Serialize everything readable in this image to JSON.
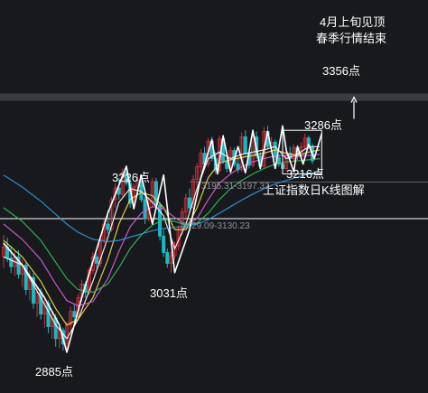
{
  "chart_data": {
    "type": "candlestick",
    "title": "上证指数日K线图解",
    "title_bottom": "",
    "note_lines": [
      "4月上旬见顶",
      "春季行情结束"
    ],
    "y_range": [
      2860,
      3400
    ],
    "grid": false,
    "colors": {
      "background": "#18191d",
      "up": "#d8323a",
      "down": "#1db8c2",
      "zigzag": "#ffffff",
      "ma5": "#ffffff",
      "ma10": "#f3e04a",
      "ma20": "#d95fd8",
      "ma30": "#33c05a",
      "ma60": "#2e9be6",
      "band": "#3a3b40"
    },
    "reference_lines": [
      3130,
      3197,
      3356
    ],
    "gaps": [
      {
        "label": "3195.31-3197.32",
        "low": 3195.31,
        "high": 3197.32
      },
      {
        "label": "3129.09-3130.23",
        "low": 3129.09,
        "high": 3130.23
      }
    ],
    "key_points": [
      {
        "label": "2885点",
        "value": 2885
      },
      {
        "label": "3226点",
        "value": 3226
      },
      {
        "label": "3031点",
        "value": 3031
      },
      {
        "label": "3286点",
        "value": 3286
      },
      {
        "label": "3216点",
        "value": 3216
      },
      {
        "label": "3356点",
        "value": 3356
      }
    ],
    "zigzag": [
      [
        0,
        3085
      ],
      [
        10,
        3045
      ],
      [
        22,
        2985
      ],
      [
        30,
        2935
      ],
      [
        34,
        2885
      ],
      [
        42,
        2985
      ],
      [
        56,
        3140
      ],
      [
        66,
        3226
      ],
      [
        70,
        3148
      ],
      [
        74,
        3210
      ],
      [
        80,
        3120
      ],
      [
        86,
        3210
      ],
      [
        92,
        3031
      ],
      [
        100,
        3110
      ],
      [
        106,
        3205
      ],
      [
        112,
        3275
      ],
      [
        115,
        3212
      ],
      [
        118,
        3282
      ],
      [
        122,
        3215
      ],
      [
        126,
        3262
      ],
      [
        130,
        3214
      ],
      [
        134,
        3292
      ],
      [
        138,
        3222
      ],
      [
        142,
        3290
      ],
      [
        146,
        3222
      ],
      [
        150,
        3300
      ],
      [
        152,
        3255
      ],
      [
        156,
        3216
      ],
      [
        158,
        3262
      ],
      [
        161,
        3230
      ],
      [
        164,
        3266
      ],
      [
        167,
        3240
      ],
      [
        171,
        3286
      ]
    ],
    "candles": [
      [
        0,
        3060,
        3100,
        3040,
        3078
      ],
      [
        2,
        3078,
        3095,
        3050,
        3058
      ],
      [
        4,
        3058,
        3080,
        3030,
        3042
      ],
      [
        6,
        3042,
        3070,
        3025,
        3060
      ],
      [
        8,
        3060,
        3072,
        3020,
        3028
      ],
      [
        10,
        3028,
        3055,
        3005,
        3045
      ],
      [
        12,
        3045,
        3050,
        2990,
        3000
      ],
      [
        14,
        3000,
        3035,
        2980,
        3022
      ],
      [
        16,
        3022,
        3030,
        2965,
        2975
      ],
      [
        18,
        2975,
        3005,
        2950,
        2995
      ],
      [
        20,
        2995,
        3002,
        2945,
        2955
      ],
      [
        22,
        2955,
        2985,
        2930,
        2975
      ],
      [
        24,
        2975,
        2980,
        2920,
        2932
      ],
      [
        26,
        2932,
        2960,
        2910,
        2948
      ],
      [
        28,
        2948,
        2955,
        2895,
        2910
      ],
      [
        30,
        2910,
        2935,
        2892,
        2925
      ],
      [
        32,
        2925,
        2930,
        2888,
        2900
      ],
      [
        34,
        2900,
        2940,
        2885,
        2935
      ],
      [
        36,
        2935,
        2968,
        2925,
        2960
      ],
      [
        38,
        2960,
        2972,
        2940,
        2950
      ],
      [
        40,
        2950,
        2992,
        2945,
        2985
      ],
      [
        42,
        2985,
        3018,
        2978,
        3010
      ],
      [
        44,
        3010,
        3015,
        2985,
        2995
      ],
      [
        46,
        2995,
        3040,
        2990,
        3035
      ],
      [
        48,
        3035,
        3068,
        3028,
        3060
      ],
      [
        50,
        3060,
        3066,
        3040,
        3048
      ],
      [
        52,
        3048,
        3098,
        3042,
        3092
      ],
      [
        54,
        3092,
        3128,
        3085,
        3120
      ],
      [
        56,
        3120,
        3145,
        3102,
        3110
      ],
      [
        58,
        3110,
        3170,
        3106,
        3165
      ],
      [
        60,
        3165,
        3195,
        3150,
        3186
      ],
      [
        62,
        3186,
        3205,
        3165,
        3175
      ],
      [
        64,
        3175,
        3222,
        3170,
        3215
      ],
      [
        66,
        3215,
        3226,
        3190,
        3195
      ],
      [
        68,
        3195,
        3205,
        3150,
        3158
      ],
      [
        70,
        3158,
        3195,
        3148,
        3188
      ],
      [
        72,
        3188,
        3210,
        3172,
        3200
      ],
      [
        74,
        3200,
        3205,
        3160,
        3165
      ],
      [
        76,
        3165,
        3175,
        3120,
        3130
      ],
      [
        78,
        3130,
        3170,
        3125,
        3160
      ],
      [
        80,
        3160,
        3205,
        3150,
        3198
      ],
      [
        82,
        3198,
        3205,
        3150,
        3155
      ],
      [
        84,
        3155,
        3160,
        3090,
        3098
      ],
      [
        86,
        3098,
        3110,
        3060,
        3068
      ],
      [
        88,
        3068,
        3075,
        3040,
        3048
      ],
      [
        90,
        3048,
        3070,
        3031,
        3062
      ],
      [
        92,
        3062,
        3088,
        3055,
        3080
      ],
      [
        94,
        3080,
        3118,
        3072,
        3110
      ],
      [
        96,
        3110,
        3150,
        3100,
        3142
      ],
      [
        98,
        3142,
        3176,
        3132,
        3168
      ],
      [
        100,
        3168,
        3185,
        3140,
        3150
      ],
      [
        102,
        3150,
        3210,
        3146,
        3202
      ],
      [
        104,
        3202,
        3232,
        3190,
        3225
      ],
      [
        106,
        3225,
        3258,
        3215,
        3250
      ],
      [
        108,
        3250,
        3262,
        3222,
        3230
      ],
      [
        110,
        3230,
        3278,
        3225,
        3272
      ],
      [
        112,
        3272,
        3280,
        3235,
        3240
      ],
      [
        114,
        3240,
        3252,
        3212,
        3218
      ],
      [
        116,
        3218,
        3282,
        3214,
        3276
      ],
      [
        118,
        3276,
        3282,
        3230,
        3236
      ],
      [
        120,
        3236,
        3245,
        3215,
        3222
      ],
      [
        122,
        3222,
        3262,
        3218,
        3255
      ],
      [
        124,
        3255,
        3260,
        3225,
        3230
      ],
      [
        126,
        3230,
        3240,
        3214,
        3220
      ],
      [
        128,
        3220,
        3288,
        3216,
        3280
      ],
      [
        130,
        3280,
        3292,
        3245,
        3250
      ],
      [
        132,
        3250,
        3258,
        3222,
        3228
      ],
      [
        134,
        3228,
        3286,
        3224,
        3280
      ],
      [
        136,
        3280,
        3290,
        3240,
        3245
      ],
      [
        138,
        3245,
        3252,
        3222,
        3226
      ],
      [
        140,
        3226,
        3298,
        3224,
        3290
      ],
      [
        142,
        3290,
        3300,
        3258,
        3262
      ],
      [
        144,
        3262,
        3280,
        3250,
        3270
      ],
      [
        146,
        3270,
        3275,
        3238,
        3242
      ],
      [
        148,
        3242,
        3248,
        3225,
        3230
      ],
      [
        150,
        3230,
        3236,
        3216,
        3222
      ],
      [
        152,
        3222,
        3255,
        3218,
        3250
      ],
      [
        154,
        3250,
        3262,
        3236,
        3240
      ],
      [
        156,
        3240,
        3266,
        3235,
        3260
      ],
      [
        158,
        3260,
        3265,
        3238,
        3244
      ],
      [
        160,
        3244,
        3270,
        3240,
        3262
      ],
      [
        162,
        3262,
        3286,
        3255,
        3278
      ],
      [
        164,
        3278,
        3282,
        3258,
        3262
      ],
      [
        166,
        3262,
        3268,
        3230,
        3236
      ]
    ],
    "moving_averages": [
      {
        "name": "MA5",
        "color": "#ffffff",
        "points": [
          [
            0,
            3060
          ],
          [
            10,
            3045
          ],
          [
            20,
            2985
          ],
          [
            28,
            2935
          ],
          [
            34,
            2910
          ],
          [
            40,
            2945
          ],
          [
            48,
            3015
          ],
          [
            56,
            3095
          ],
          [
            62,
            3160
          ],
          [
            68,
            3185
          ],
          [
            74,
            3180
          ],
          [
            80,
            3160
          ],
          [
            86,
            3135
          ],
          [
            92,
            3075
          ],
          [
            98,
            3120
          ],
          [
            104,
            3185
          ],
          [
            110,
            3240
          ],
          [
            116,
            3252
          ],
          [
            122,
            3240
          ],
          [
            128,
            3248
          ],
          [
            134,
            3252
          ],
          [
            140,
            3256
          ],
          [
            146,
            3262
          ],
          [
            152,
            3240
          ],
          [
            158,
            3248
          ],
          [
            164,
            3262
          ],
          [
            170,
            3262
          ]
        ]
      },
      {
        "name": "MA10",
        "color": "#f3e04a",
        "points": [
          [
            0,
            3090
          ],
          [
            10,
            3060
          ],
          [
            20,
            3015
          ],
          [
            28,
            2965
          ],
          [
            34,
            2935
          ],
          [
            40,
            2945
          ],
          [
            48,
            2985
          ],
          [
            56,
            3055
          ],
          [
            62,
            3120
          ],
          [
            68,
            3165
          ],
          [
            74,
            3178
          ],
          [
            80,
            3172
          ],
          [
            86,
            3150
          ],
          [
            92,
            3110
          ],
          [
            98,
            3110
          ],
          [
            104,
            3150
          ],
          [
            110,
            3205
          ],
          [
            116,
            3232
          ],
          [
            122,
            3238
          ],
          [
            128,
            3242
          ],
          [
            134,
            3246
          ],
          [
            140,
            3250
          ],
          [
            146,
            3256
          ],
          [
            152,
            3250
          ],
          [
            158,
            3246
          ],
          [
            164,
            3252
          ],
          [
            170,
            3256
          ]
        ]
      },
      {
        "name": "MA20",
        "color": "#d95fd8",
        "points": [
          [
            0,
            3120
          ],
          [
            10,
            3092
          ],
          [
            20,
            3055
          ],
          [
            28,
            3010
          ],
          [
            34,
            2980
          ],
          [
            40,
            2970
          ],
          [
            48,
            2978
          ],
          [
            56,
            3020
          ],
          [
            62,
            3070
          ],
          [
            68,
            3115
          ],
          [
            74,
            3140
          ],
          [
            80,
            3152
          ],
          [
            86,
            3148
          ],
          [
            92,
            3132
          ],
          [
            98,
            3118
          ],
          [
            104,
            3130
          ],
          [
            110,
            3165
          ],
          [
            116,
            3195
          ],
          [
            122,
            3212
          ],
          [
            128,
            3225
          ],
          [
            134,
            3234
          ],
          [
            140,
            3240
          ],
          [
            146,
            3245
          ],
          [
            152,
            3246
          ],
          [
            158,
            3244
          ],
          [
            164,
            3246
          ],
          [
            170,
            3248
          ]
        ]
      },
      {
        "name": "MA30",
        "color": "#33c05a",
        "points": [
          [
            0,
            3150
          ],
          [
            10,
            3125
          ],
          [
            20,
            3090
          ],
          [
            28,
            3050
          ],
          [
            34,
            3020
          ],
          [
            40,
            3000
          ],
          [
            48,
            2995
          ],
          [
            56,
            3010
          ],
          [
            62,
            3040
          ],
          [
            68,
            3075
          ],
          [
            74,
            3100
          ],
          [
            80,
            3118
          ],
          [
            86,
            3128
          ],
          [
            92,
            3125
          ],
          [
            98,
            3118
          ],
          [
            104,
            3122
          ],
          [
            110,
            3140
          ],
          [
            116,
            3165
          ],
          [
            122,
            3185
          ],
          [
            128,
            3200
          ],
          [
            134,
            3212
          ],
          [
            140,
            3222
          ],
          [
            146,
            3230
          ],
          [
            152,
            3234
          ],
          [
            158,
            3236
          ],
          [
            164,
            3238
          ],
          [
            170,
            3240
          ]
        ]
      },
      {
        "name": "MA60",
        "color": "#2e9be6",
        "points": [
          [
            0,
            3210
          ],
          [
            10,
            3188
          ],
          [
            20,
            3162
          ],
          [
            28,
            3138
          ],
          [
            34,
            3120
          ],
          [
            40,
            3105
          ],
          [
            48,
            3092
          ],
          [
            56,
            3088
          ],
          [
            62,
            3090
          ],
          [
            68,
            3096
          ],
          [
            74,
            3102
          ],
          [
            80,
            3108
          ],
          [
            86,
            3112
          ],
          [
            92,
            3114
          ],
          [
            98,
            3116
          ],
          [
            104,
            3120
          ],
          [
            110,
            3128
          ],
          [
            116,
            3140
          ],
          [
            122,
            3152
          ],
          [
            128,
            3164
          ],
          [
            134,
            3175
          ],
          [
            140,
            3185
          ],
          [
            146,
            3194
          ],
          [
            152,
            3200
          ],
          [
            158,
            3206
          ],
          [
            164,
            3212
          ],
          [
            170,
            3218
          ]
        ]
      }
    ]
  }
}
